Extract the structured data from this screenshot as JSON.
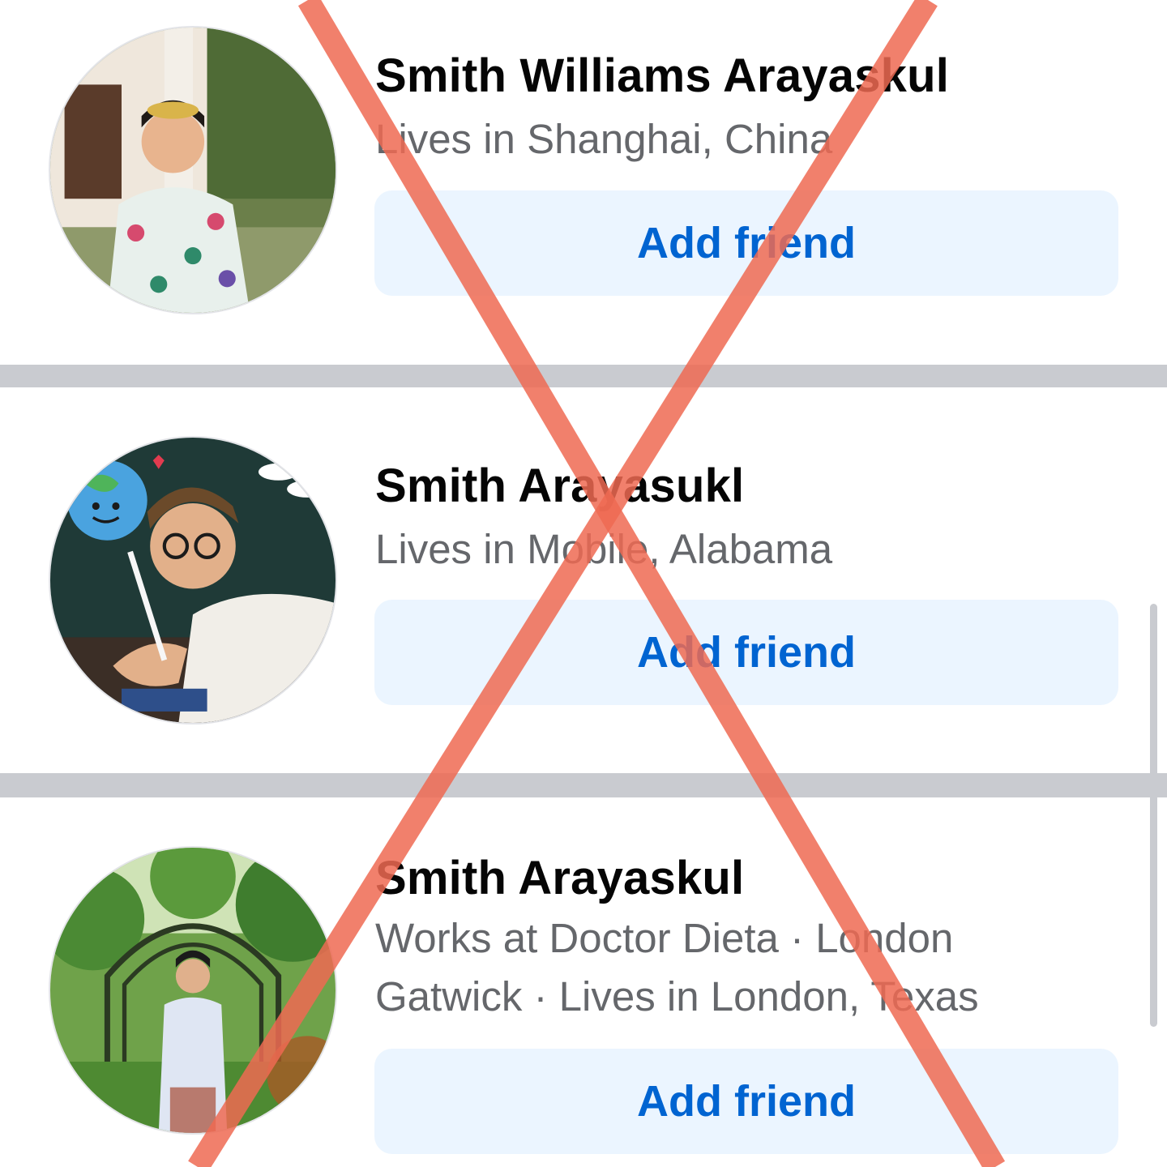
{
  "results": [
    {
      "name": "Smith Williams Arayaskul",
      "info": "Lives in Shanghai, China",
      "button_label": "Add friend"
    },
    {
      "name": "Smith Arayasukl",
      "info": "Lives in Mobile, Alabama",
      "button_label": "Add friend"
    },
    {
      "name": "Smith Arayaskul",
      "info": "Works at Doctor Dieta · London Gatwick · Lives in London, Texas",
      "button_label": "Add friend"
    }
  ],
  "colors": {
    "button_bg": "#ebf5ff",
    "button_text": "#0064d1",
    "name_text": "#050505",
    "info_text": "#65676b",
    "separator": "#c9cbd0",
    "cross_overlay": "#ee6a52"
  },
  "overlay": {
    "icon": "red-cross-mark"
  }
}
